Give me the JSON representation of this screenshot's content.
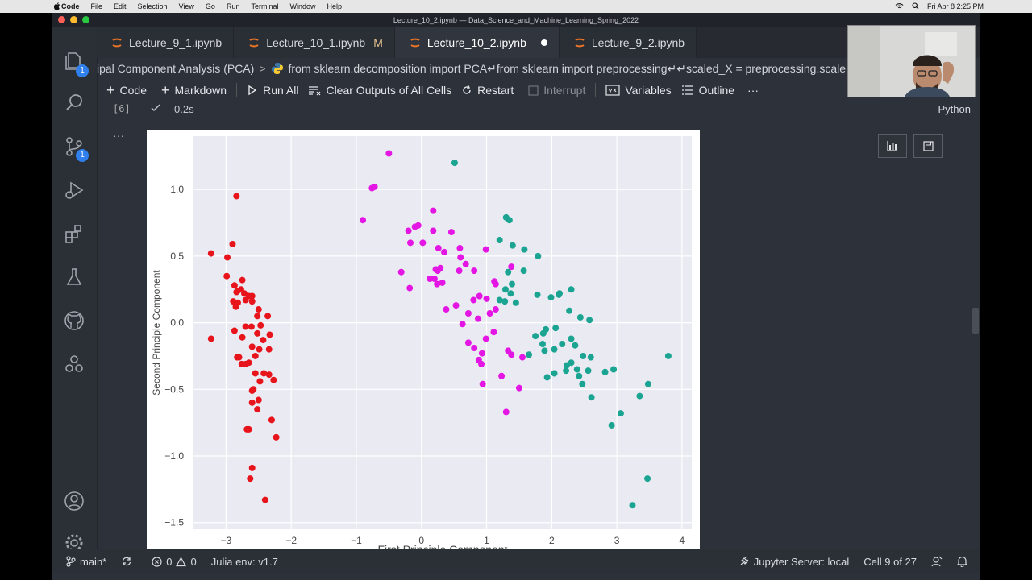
{
  "menubar": {
    "app": "Code",
    "items": [
      "File",
      "Edit",
      "Selection",
      "View",
      "Go",
      "Run",
      "Terminal",
      "Window",
      "Help"
    ],
    "clock": "Fri Apr 8  2:25 PM"
  },
  "window": {
    "title": "Lecture_10_2.ipynb — Data_Science_and_Machine_Learning_Spring_2022"
  },
  "activity_bar": {
    "explorer_badge": "1",
    "scm_badge": "1"
  },
  "tabs": [
    {
      "label": "Lecture_9_1.ipynb"
    },
    {
      "label": "Lecture_10_1.ipynb",
      "modifier": "M"
    },
    {
      "label": "Lecture_10_2.ipynb"
    },
    {
      "label": "Lecture_9_2.ipynb"
    }
  ],
  "breadcrumb": {
    "section": "ipal Component Analysis (PCA)",
    "code": "from sklearn.decomposition import PCA↵from sklearn import preprocessing↵↵scaled_X = preprocessing.scale"
  },
  "toolbar": {
    "code": "Code",
    "markdown": "Markdown",
    "run_all": "Run All",
    "clear_outputs": "Clear Outputs of All Cells",
    "restart": "Restart",
    "interrupt": "Interrupt",
    "variables": "Variables",
    "outline": "Outline",
    "more": "···"
  },
  "cell": {
    "exec_count": "[6]",
    "duration": "0.2s",
    "language": "Python",
    "output_more": "···"
  },
  "statusbar": {
    "branch": "main*",
    "errors": "0",
    "warnings": "0",
    "julia_env": "Julia env: v1.7",
    "jupyter_server": "Jupyter Server: local",
    "cell_position": "Cell 9 of 27"
  },
  "chart_data": {
    "type": "scatter",
    "xlabel": "First Principle Component",
    "ylabel": "Second Principle Component",
    "xlim": [
      -3.5,
      4.15
    ],
    "ylim": [
      -1.55,
      1.4
    ],
    "xticks": [
      "−3",
      "−2",
      "−1",
      "0",
      "1",
      "2",
      "3",
      "4"
    ],
    "yticks": [
      "1.0",
      "0.5",
      "0.0",
      "−0.5",
      "−1.0",
      "−1.5"
    ],
    "grid": true,
    "series": [
      {
        "color": "#e8141c",
        "points": [
          [
            -2.84,
            0.95
          ],
          [
            -3.23,
            0.52
          ],
          [
            -2.98,
            0.49
          ],
          [
            -2.9,
            0.59
          ],
          [
            -2.99,
            0.35
          ],
          [
            -2.75,
            0.32
          ],
          [
            -2.87,
            0.28
          ],
          [
            -2.82,
            0.24
          ],
          [
            -2.77,
            0.25
          ],
          [
            -2.72,
            0.22
          ],
          [
            -2.84,
            0.23
          ],
          [
            -2.89,
            0.16
          ],
          [
            -2.65,
            0.2
          ],
          [
            -2.6,
            0.2
          ],
          [
            -2.82,
            0.15
          ],
          [
            -2.7,
            0.17
          ],
          [
            -2.85,
            0.12
          ],
          [
            -2.6,
            0.16
          ],
          [
            -2.5,
            0.1
          ],
          [
            -2.52,
            0.05
          ],
          [
            -2.36,
            0.05
          ],
          [
            -2.47,
            -0.02
          ],
          [
            -2.61,
            -0.03
          ],
          [
            -2.7,
            -0.03
          ],
          [
            -2.87,
            -0.06
          ],
          [
            -2.52,
            -0.08
          ],
          [
            -2.33,
            -0.09
          ],
          [
            -2.75,
            -0.11
          ],
          [
            -2.43,
            -0.13
          ],
          [
            -3.23,
            -0.12
          ],
          [
            -2.6,
            -0.18
          ],
          [
            -2.34,
            -0.2
          ],
          [
            -2.49,
            -0.2
          ],
          [
            -2.8,
            -0.26
          ],
          [
            -2.83,
            -0.26
          ],
          [
            -2.55,
            -0.25
          ],
          [
            -2.65,
            -0.3
          ],
          [
            -2.7,
            -0.31
          ],
          [
            -2.76,
            -0.31
          ],
          [
            -2.55,
            -0.38
          ],
          [
            -2.42,
            -0.38
          ],
          [
            -2.34,
            -0.39
          ],
          [
            -2.27,
            -0.43
          ],
          [
            -2.48,
            -0.44
          ],
          [
            -2.58,
            -0.5
          ],
          [
            -2.6,
            -0.51
          ],
          [
            -2.6,
            -0.6
          ],
          [
            -2.5,
            -0.58
          ],
          [
            -2.52,
            -0.65
          ],
          [
            -2.3,
            -0.73
          ],
          [
            -2.68,
            -0.8
          ],
          [
            -2.65,
            -0.8
          ],
          [
            -2.23,
            -0.86
          ],
          [
            -2.6,
            -1.09
          ],
          [
            -2.63,
            -1.17
          ],
          [
            -2.4,
            -1.33
          ]
        ]
      },
      {
        "color": "#e416e4",
        "points": [
          [
            -0.5,
            1.27
          ],
          [
            -0.72,
            1.02
          ],
          [
            -0.76,
            1.01
          ],
          [
            -0.9,
            0.77
          ],
          [
            0.18,
            0.84
          ],
          [
            -0.05,
            0.73
          ],
          [
            -0.1,
            0.72
          ],
          [
            -0.2,
            0.69
          ],
          [
            0.18,
            0.69
          ],
          [
            0.46,
            0.68
          ],
          [
            0.02,
            0.6
          ],
          [
            -0.17,
            0.6
          ],
          [
            0.26,
            0.56
          ],
          [
            0.35,
            0.53
          ],
          [
            0.59,
            0.56
          ],
          [
            0.99,
            0.55
          ],
          [
            0.6,
            0.49
          ],
          [
            0.68,
            0.44
          ],
          [
            0.58,
            0.39
          ],
          [
            0.81,
            0.39
          ],
          [
            0.29,
            0.41
          ],
          [
            0.22,
            0.4
          ],
          [
            0.25,
            0.39
          ],
          [
            0.2,
            0.33
          ],
          [
            0.13,
            0.33
          ],
          [
            0.32,
            0.3
          ],
          [
            0.24,
            0.29
          ],
          [
            -0.31,
            0.38
          ],
          [
            -0.18,
            0.26
          ],
          [
            1.12,
            0.31
          ],
          [
            1.14,
            0.29
          ],
          [
            1.38,
            0.42
          ],
          [
            0.89,
            0.2
          ],
          [
            0.8,
            0.17
          ],
          [
            1.0,
            0.18
          ],
          [
            0.53,
            0.13
          ],
          [
            0.38,
            0.1
          ],
          [
            1.14,
            0.1
          ],
          [
            0.72,
            0.07
          ],
          [
            1.05,
            0.07
          ],
          [
            0.87,
            0.03
          ],
          [
            0.63,
            -0.01
          ],
          [
            1.11,
            -0.07
          ],
          [
            0.99,
            -0.12
          ],
          [
            0.72,
            -0.15
          ],
          [
            0.81,
            -0.19
          ],
          [
            1.33,
            -0.21
          ],
          [
            0.93,
            -0.23
          ],
          [
            1.38,
            -0.24
          ],
          [
            1.55,
            -0.26
          ],
          [
            0.88,
            -0.28
          ],
          [
            0.92,
            -0.31
          ],
          [
            1.23,
            -0.4
          ],
          [
            1.5,
            -0.49
          ],
          [
            0.94,
            -0.46
          ],
          [
            1.3,
            -0.67
          ]
        ]
      },
      {
        "color": "#1aa491",
        "points": [
          [
            0.51,
            1.2
          ],
          [
            1.3,
            0.79
          ],
          [
            1.35,
            0.77
          ],
          [
            1.2,
            0.62
          ],
          [
            1.4,
            0.58
          ],
          [
            1.58,
            0.55
          ],
          [
            1.79,
            0.5
          ],
          [
            1.57,
            0.39
          ],
          [
            1.33,
            0.38
          ],
          [
            1.39,
            0.29
          ],
          [
            1.29,
            0.25
          ],
          [
            1.37,
            0.22
          ],
          [
            2.3,
            0.25
          ],
          [
            2.12,
            0.22
          ],
          [
            2.11,
            0.21
          ],
          [
            1.78,
            0.21
          ],
          [
            1.99,
            0.19
          ],
          [
            1.2,
            0.17
          ],
          [
            1.28,
            0.16
          ],
          [
            1.45,
            0.15
          ],
          [
            2.27,
            0.09
          ],
          [
            2.44,
            0.04
          ],
          [
            2.58,
            0.02
          ],
          [
            2.06,
            -0.04
          ],
          [
            1.91,
            -0.05
          ],
          [
            1.87,
            -0.08
          ],
          [
            1.75,
            -0.1
          ],
          [
            2.3,
            -0.12
          ],
          [
            1.86,
            -0.16
          ],
          [
            2.16,
            -0.16
          ],
          [
            2.36,
            -0.17
          ],
          [
            2.04,
            -0.2
          ],
          [
            1.89,
            -0.21
          ],
          [
            2.48,
            -0.25
          ],
          [
            2.6,
            -0.26
          ],
          [
            1.65,
            -0.24
          ],
          [
            2.3,
            -0.3
          ],
          [
            2.39,
            -0.35
          ],
          [
            2.56,
            -0.36
          ],
          [
            2.23,
            -0.32
          ],
          [
            2.42,
            -0.4
          ],
          [
            2.22,
            -0.36
          ],
          [
            2.04,
            -0.38
          ],
          [
            1.93,
            -0.41
          ],
          [
            2.82,
            -0.37
          ],
          [
            2.95,
            -0.35
          ],
          [
            2.47,
            -0.46
          ],
          [
            3.35,
            -0.55
          ],
          [
            3.48,
            -0.46
          ],
          [
            3.79,
            -0.25
          ],
          [
            2.61,
            -0.56
          ],
          [
            3.06,
            -0.68
          ],
          [
            2.92,
            -0.77
          ],
          [
            3.47,
            -1.17
          ],
          [
            3.24,
            -1.37
          ]
        ]
      }
    ]
  }
}
